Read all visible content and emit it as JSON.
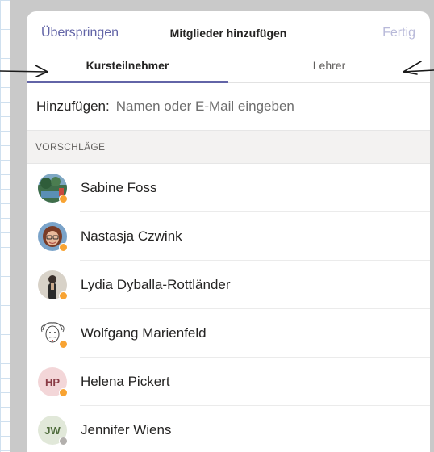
{
  "header": {
    "skip_label": "Überspringen",
    "title": "Mitglieder hinzufügen",
    "done_label": "Fertig"
  },
  "tabs": [
    {
      "label": "Kursteilnehmer",
      "selected": true
    },
    {
      "label": "Lehrer",
      "selected": false
    }
  ],
  "add": {
    "label": "Hinzufügen:",
    "placeholder": "Namen oder E-Mail eingeben"
  },
  "suggestions": {
    "header": "VORSCHLÄGE",
    "people": [
      {
        "name": "Sabine Foss",
        "avatar": "photo-landscape",
        "status": "away",
        "status_color": "#f8a332"
      },
      {
        "name": "Nastasja Czwink",
        "avatar": "photo-woman-glasses",
        "status": "away",
        "status_color": "#f8a332"
      },
      {
        "name": "Lydia Dyballa-Rottländer",
        "avatar": "photo-person",
        "status": "away",
        "status_color": "#f8a332"
      },
      {
        "name": "Wolfgang Marienfeld",
        "avatar": "photo-einstein-sketch",
        "status": "away",
        "status_color": "#f8a332"
      },
      {
        "name": "Helena Pickert",
        "initials": "HP",
        "avatar_bg": "#f3d6d8",
        "avatar_fg": "#8a3b45",
        "status": "away",
        "status_color": "#f8a332"
      },
      {
        "name": "Jennifer Wiens",
        "initials": "JW",
        "avatar_bg": "#e1e8d9",
        "avatar_fg": "#4d6a3a",
        "status": "offline",
        "status_color": "#b3b0ad"
      }
    ]
  },
  "colors": {
    "accent": "#6264a7",
    "disabled": "#b8b9d9",
    "away": "#f8a332",
    "offline": "#b3b0ad"
  }
}
